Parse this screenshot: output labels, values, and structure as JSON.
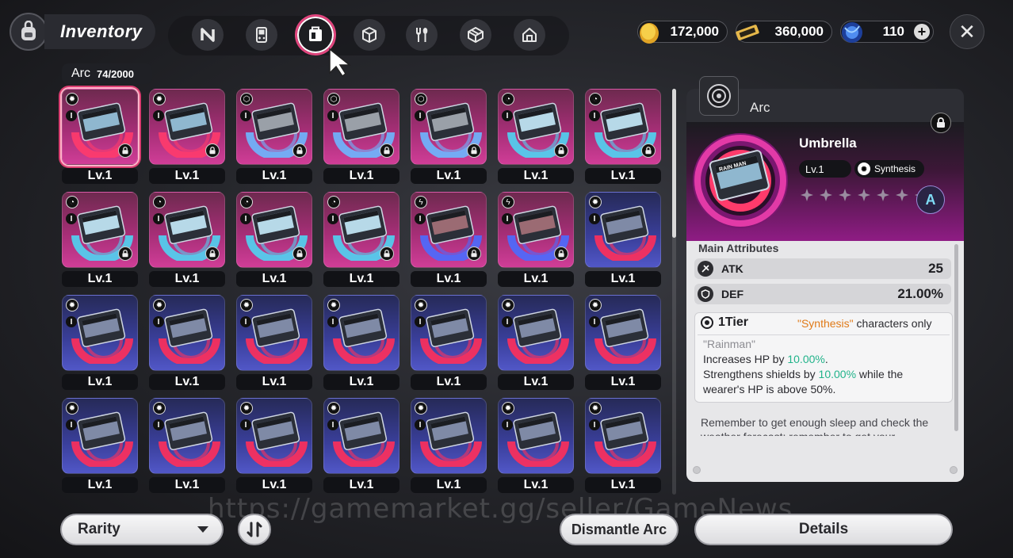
{
  "header": {
    "title": "Inventory",
    "tabs": [
      {
        "icon": "n-logo-icon"
      },
      {
        "icon": "handheld-console-icon"
      },
      {
        "icon": "arc-chip-icon",
        "active": true
      },
      {
        "icon": "cube-icon"
      },
      {
        "icon": "fork-spoon-icon"
      },
      {
        "icon": "box-icon"
      },
      {
        "icon": "house-icon"
      }
    ],
    "resources": [
      {
        "icon": "gold-coin-icon",
        "value": "172,000"
      },
      {
        "icon": "ticket-icon",
        "value": "360,000"
      },
      {
        "icon": "blue-gem-icon",
        "value": "110",
        "addable": true
      }
    ],
    "close_label": "✕"
  },
  "grid": {
    "category": "Arc",
    "count": "74/2000",
    "level_label": "Lv.1",
    "lock_symbol": "🔒",
    "tier_symbol": "I",
    "cards": [
      {
        "frame": "pink",
        "art": "rainman",
        "type": "gear",
        "locked": true,
        "selected": true
      },
      {
        "frame": "pink",
        "art": "rainman",
        "type": "gear",
        "locked": true
      },
      {
        "frame": "pink",
        "art": "crt",
        "type": "cube",
        "locked": true
      },
      {
        "frame": "pink",
        "art": "crt",
        "type": "cube",
        "locked": true
      },
      {
        "frame": "pink",
        "art": "crt",
        "type": "cube",
        "locked": true
      },
      {
        "frame": "pink",
        "art": "wave",
        "type": "swirl",
        "locked": true
      },
      {
        "frame": "pink",
        "art": "wave",
        "type": "swirl",
        "locked": true
      },
      {
        "frame": "pink",
        "art": "wave",
        "type": "swirl",
        "locked": true
      },
      {
        "frame": "pink",
        "art": "wave",
        "type": "swirl",
        "locked": true
      },
      {
        "frame": "pink",
        "art": "wave",
        "type": "swirl",
        "locked": true
      },
      {
        "frame": "pink",
        "art": "wave",
        "type": "swirl",
        "locked": true
      },
      {
        "frame": "pink",
        "art": "storm",
        "type": "bolt",
        "locked": true
      },
      {
        "frame": "pink",
        "art": "storm",
        "type": "bolt",
        "locked": true
      },
      {
        "frame": "blue",
        "art": "disc",
        "type": "gear",
        "locked": false
      },
      {
        "frame": "blue",
        "art": "disc",
        "type": "gear",
        "locked": false
      },
      {
        "frame": "blue",
        "art": "disc",
        "type": "gear",
        "locked": false
      },
      {
        "frame": "blue",
        "art": "disc",
        "type": "gear",
        "locked": false
      },
      {
        "frame": "blue",
        "art": "disc",
        "type": "gear",
        "locked": false
      },
      {
        "frame": "blue",
        "art": "disc",
        "type": "gear",
        "locked": false
      },
      {
        "frame": "blue",
        "art": "disc",
        "type": "gear",
        "locked": false
      },
      {
        "frame": "blue",
        "art": "disc",
        "type": "gear",
        "locked": false
      },
      {
        "frame": "blue",
        "art": "disc",
        "type": "gear",
        "locked": false
      },
      {
        "frame": "blue",
        "art": "disc",
        "type": "gear",
        "locked": false
      },
      {
        "frame": "blue",
        "art": "disc",
        "type": "gear",
        "locked": false
      },
      {
        "frame": "blue",
        "art": "disc",
        "type": "gear",
        "locked": false
      },
      {
        "frame": "blue",
        "art": "disc",
        "type": "gear",
        "locked": false
      },
      {
        "frame": "blue",
        "art": "disc",
        "type": "gear",
        "locked": false
      },
      {
        "frame": "blue",
        "art": "disc",
        "type": "gear",
        "locked": false
      }
    ]
  },
  "detail": {
    "type_label": "Arc",
    "name": "Umbrella",
    "level": "Lv.1",
    "class": "Synthesis",
    "badge": "A",
    "stars_total": 7,
    "stars_filled": 0,
    "main_attributes_label": "Main Attributes",
    "stats": [
      {
        "icon": "sword-icon",
        "name": "ATK",
        "value": "25"
      },
      {
        "icon": "shield-icon",
        "name": "DEF",
        "value": "21.00%"
      }
    ],
    "tier": {
      "label": "1Tier",
      "condition_highlight": "\"Synthesis\"",
      "condition_rest": " characters only"
    },
    "effect_quote": "\"Rainman\"",
    "effect_line1_pre": "Increases HP by ",
    "effect_line1_val": "10.00%",
    "effect_line1_post": ".",
    "effect_line2_pre": "Strengthens shields by ",
    "effect_line2_val": "10.00%",
    "effect_line2_post": " while the",
    "effect_line3": "wearer's HP is above 50%.",
    "flavor": "Remember to get enough sleep and check the weather forecast; remember to get your"
  },
  "footer": {
    "rarity_label": "Rarity",
    "dismantle_label": "Dismantle Arc",
    "details_label": "Details"
  },
  "watermark": "https://gamemarket.gg/seller/GameNews",
  "colors": {
    "accent_pink": "#d93d70",
    "rare_pink": "#c23590",
    "common_blue": "#4148b0",
    "highlight_green": "#21b38a",
    "highlight_orange": "#e07a18"
  }
}
